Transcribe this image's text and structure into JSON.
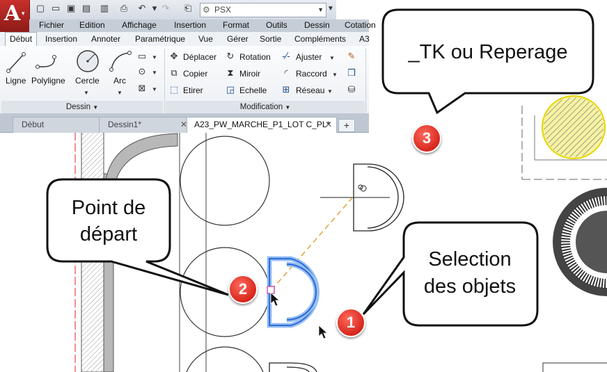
{
  "quick_access": {
    "app_letter": "A",
    "workspace": "PSX"
  },
  "menubar": [
    "Fichier",
    "Edition",
    "Affichage",
    "Insertion",
    "Format",
    "Outils",
    "Dessin",
    "Cotation"
  ],
  "ribbon_tabs": [
    "Début",
    "Insertion",
    "Annoter",
    "Paramétrique",
    "Vue",
    "Gérer",
    "Sortie",
    "Compléments",
    "A3"
  ],
  "ribbon": {
    "dessin": {
      "title": "Dessin",
      "tools": [
        "Ligne",
        "Polyligne",
        "Cercle",
        "Arc"
      ]
    },
    "modification": {
      "title": "Modification",
      "tools": [
        "Déplacer",
        "Rotation",
        "Ajuster",
        "Copier",
        "Miroir",
        "Raccord",
        "Etirer",
        "Echelle",
        "Réseau"
      ]
    }
  },
  "doc_tabs": [
    "Début",
    "Dessin1*",
    "A23_PW_MARCHE_P1_LOT C_PL*"
  ],
  "callouts": {
    "tk": "_TK ou Reperage",
    "start_line1": "Point de",
    "start_line2": "départ",
    "select_line1": "Selection",
    "select_line2": "des objets"
  },
  "badges": [
    "1",
    "2",
    "3"
  ],
  "colors": {
    "badge": "#e0342a",
    "selection": "#2f6fd6",
    "highlight_oval": "#e0342a",
    "hatch_fill": "#f3ef7a"
  }
}
